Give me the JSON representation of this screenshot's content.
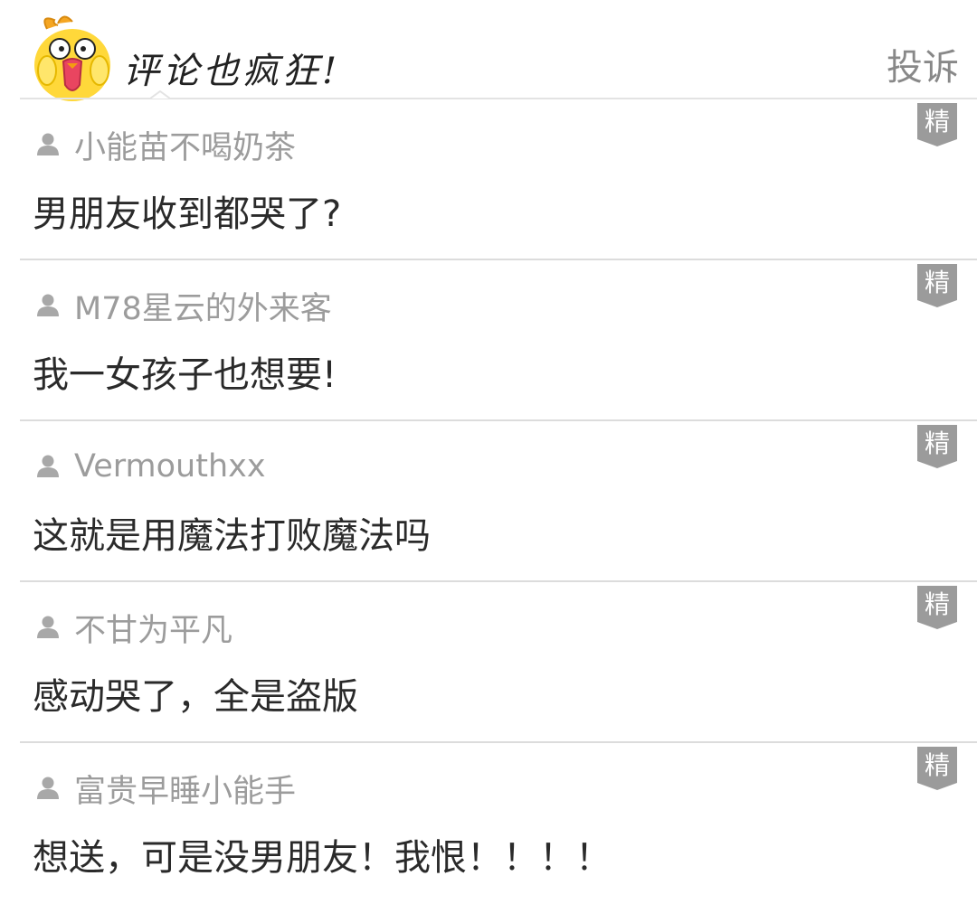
{
  "header": {
    "title": "评论也疯狂!",
    "report_label": "投诉",
    "mascot_icon": "yellow-chick-mascot-icon"
  },
  "badge_label": "精",
  "colors": {
    "username": "#9c9c9c",
    "comment_text": "#2a2a2a",
    "badge": "#9b9b9b",
    "separator": "#dcdcdc",
    "report": "#888888"
  },
  "comments": [
    {
      "username": "小能苗不喝奶茶",
      "text": "男朋友收到都哭了?"
    },
    {
      "username": "M78星云的外来客",
      "text": "我一女孩子也想要!"
    },
    {
      "username": "Vermouthxx",
      "text": "这就是用魔法打败魔法吗"
    },
    {
      "username": "不甘为平凡",
      "text": "感动哭了，全是盗版"
    },
    {
      "username": "富贵早睡小能手",
      "text": "想送，可是没男朋友！我恨！！！！"
    }
  ]
}
